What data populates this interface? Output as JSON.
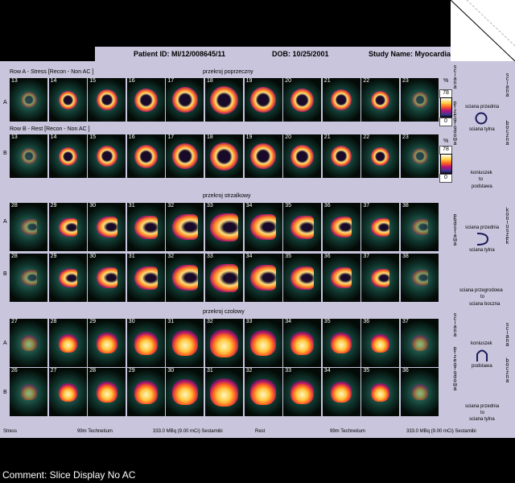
{
  "header": {
    "patient_id": "Patient ID: MI/12/008645/11",
    "dob": "DOB: 10/25/2001",
    "study_name": "Study Name: Myocardial P"
  },
  "sections": {
    "short_axis": "przekroj poprzeczny",
    "sagittal": "przekroj strzalkowy",
    "frontal": "przekroj czolowy"
  },
  "row_headers": {
    "row_a": "Row A - Stress [Recon - Non AC ]",
    "row_b": "Row B - Rest [Recon - Non AC ]"
  },
  "rows": [
    {
      "tag": "A",
      "slices": [
        "13",
        "14",
        "15",
        "16",
        "17",
        "18",
        "19",
        "20",
        "21",
        "22",
        "23"
      ]
    },
    {
      "tag": "B",
      "slices": [
        "13",
        "14",
        "15",
        "16",
        "17",
        "18",
        "19",
        "20",
        "21",
        "22",
        "23"
      ]
    },
    {
      "tag": "A",
      "slices": [
        "28",
        "29",
        "30",
        "31",
        "32",
        "33",
        "34",
        "35",
        "36",
        "37",
        "38"
      ]
    },
    {
      "tag": "B",
      "slices": [
        "28",
        "29",
        "30",
        "31",
        "32",
        "33",
        "34",
        "35",
        "36",
        "37",
        "38"
      ]
    },
    {
      "tag": "A",
      "slices": [
        "27",
        "28",
        "29",
        "30",
        "31",
        "32",
        "33",
        "34",
        "35",
        "36",
        "37"
      ]
    },
    {
      "tag": "B",
      "slices": [
        "26",
        "27",
        "28",
        "29",
        "30",
        "31",
        "32",
        "33",
        "34",
        "35",
        "36"
      ]
    }
  ],
  "scale": {
    "unit": "%",
    "max": "78",
    "min": "0"
  },
  "vertical_labels": {
    "sciana_label": "sciana",
    "przegrodowa_label": "przegrodowa",
    "sciana_right": "sciana",
    "boczna_right": "boczna",
    "podstawa_left": "podstawa",
    "koniuszek_right": "koniuszek",
    "sciana_lower_left": "sciana",
    "przegrodowa_lower": "przegrodowa",
    "sciana_lower_right": "sciana",
    "boczna_lower_right": "boczna"
  },
  "legend": {
    "short_top": "sciana przednia",
    "short_bottom": "sciana tylna",
    "koniuszek_to": "koniuszek",
    "to1": "to",
    "podstawa1": "podstawa",
    "sag_top": "sciana przednia",
    "sag_bottom": "sciana tylna",
    "przegrodowa_to": "sciana przegrodowa",
    "to2": "to",
    "boczna": "sciana boczna",
    "frontal_top": "koniuszek",
    "frontal_bottom": "podstawa",
    "bottom_a": "sciana przednia",
    "to3": "to",
    "bottom_b": "sciana tylna"
  },
  "footer": {
    "stress": "Stress",
    "tech1": "99m Technetium",
    "dose1": "333.0 MBq (9.00 mCi) Sestamibi",
    "rest": "Rest",
    "tech2": "99m Technetium",
    "dose2": "333.0 MBq (9.00 mCi) Sestamibi"
  },
  "comment": "Comment: Slice Display No AC"
}
